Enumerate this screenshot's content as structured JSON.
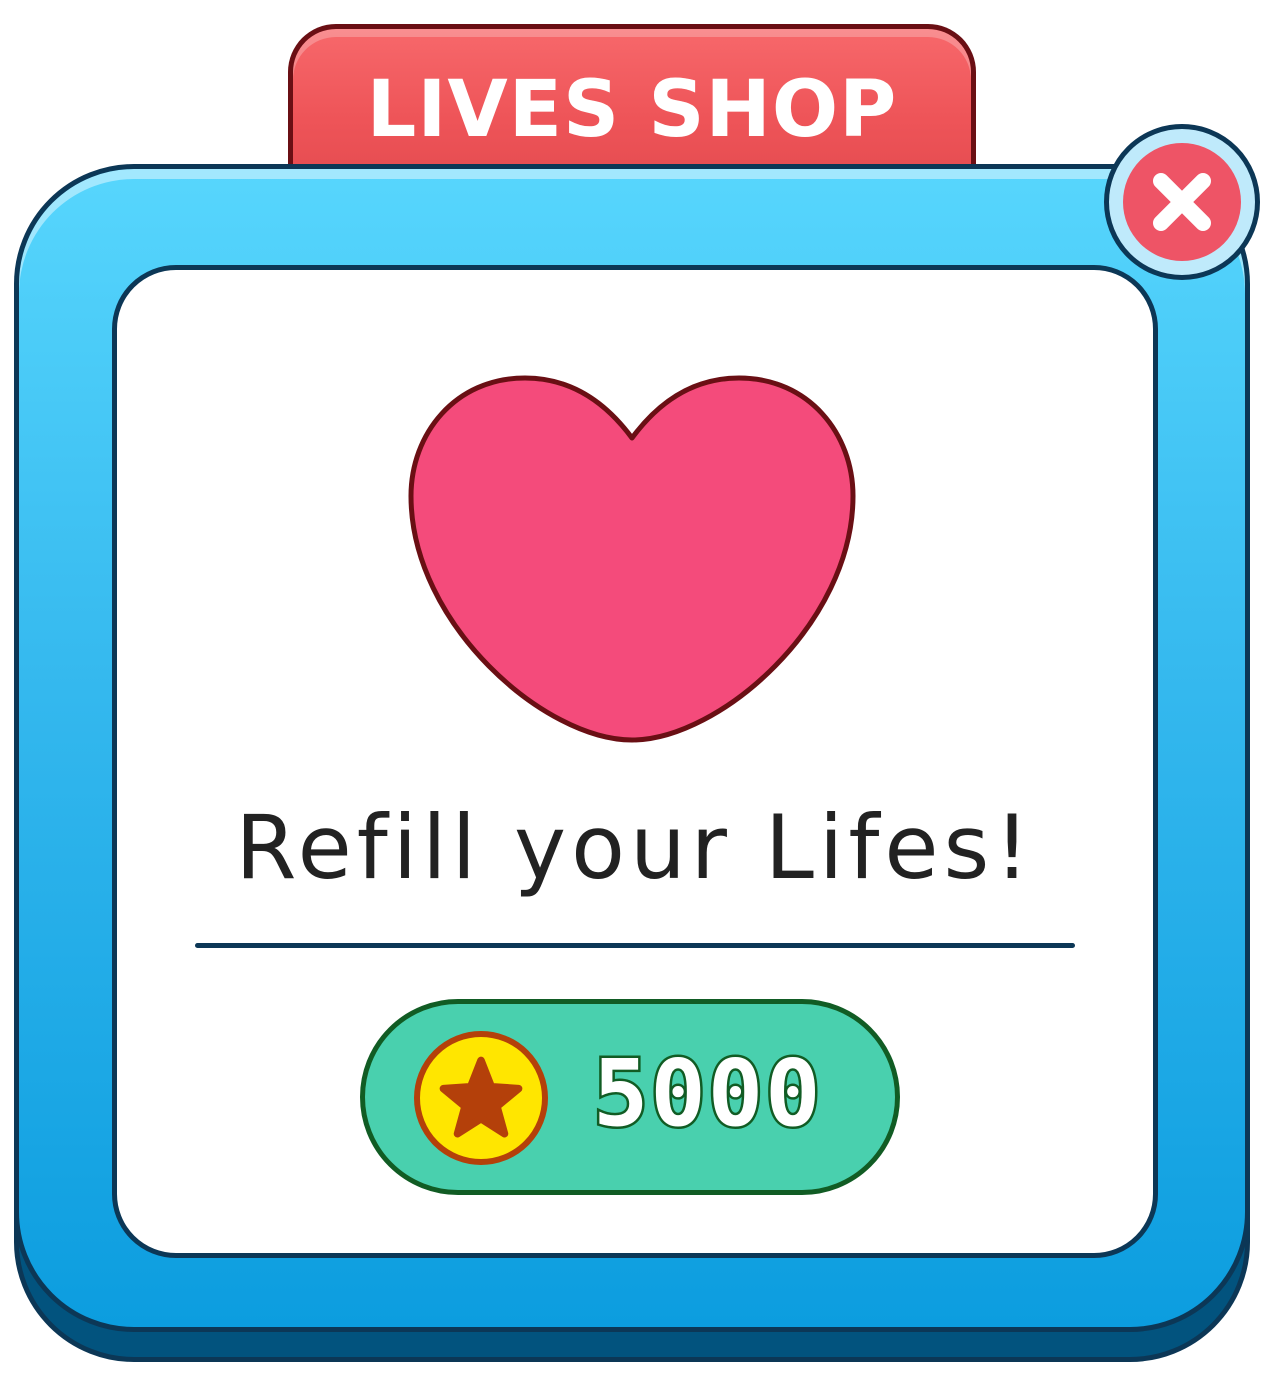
{
  "dialog": {
    "title": "LIVES SHOP",
    "heading": "Refill your Lifes!",
    "price": "5000",
    "icons": {
      "item": "heart-icon",
      "currency": "star-coin-icon",
      "close": "close-icon"
    },
    "colors": {
      "frame": "#34b8ee",
      "title_tab": "#ee5458",
      "heart": "#f44b7b",
      "buy_button": "#49d0ae",
      "coin": "#ffe600",
      "close": "#ee5466"
    }
  }
}
